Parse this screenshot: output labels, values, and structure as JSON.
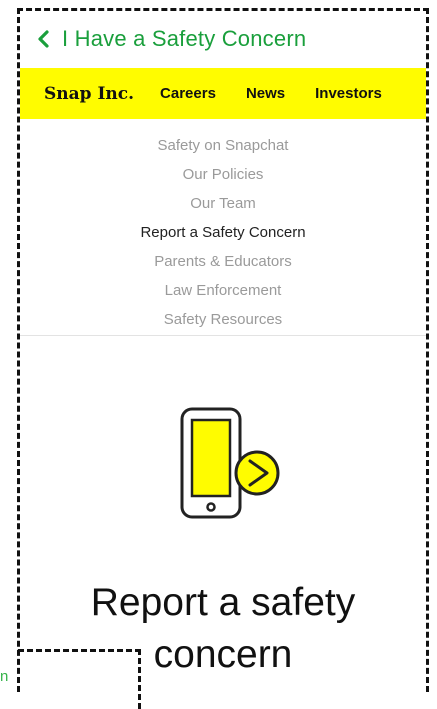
{
  "header": {
    "back_title": "I Have a Safety Concern"
  },
  "nav": {
    "brand": "Snap Inc.",
    "links": [
      "Careers",
      "News",
      "Investors"
    ],
    "background": "#fffc00"
  },
  "submenu": {
    "items": [
      "Safety on Snapchat",
      "Our Policies",
      "Our Team",
      "Report a Safety Concern",
      "Parents & Educators",
      "Law Enforcement",
      "Safety Resources"
    ],
    "active_index": 3
  },
  "hero": {
    "icon": "phone-with-arrow-icon",
    "title_line1": "Report a safety",
    "title_line2": "concern"
  },
  "fragment": {
    "text": "n"
  },
  "colors": {
    "accent_green": "#1a9f3c",
    "brand_yellow": "#fffc00"
  }
}
